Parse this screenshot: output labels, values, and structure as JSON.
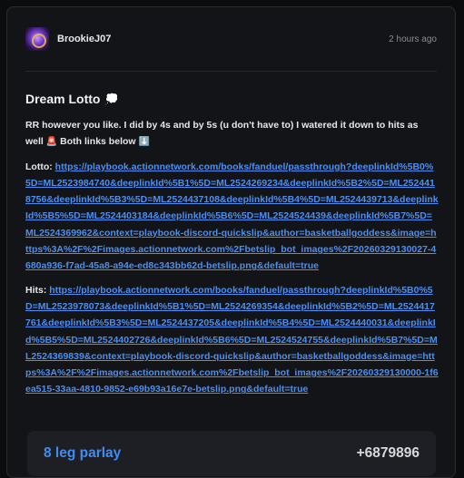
{
  "post": {
    "author": "BrookieJ07",
    "timestamp": "2 hours ago",
    "title": "Dream Lotto",
    "title_emoji": "💭",
    "description": "RR however you like. I did by 4s and by 5s (u don't have to) I watered it down to hits as well",
    "siren_emoji": "🚨",
    "description_tail": "Both links below",
    "arrow_emoji": "⬇️"
  },
  "links": [
    {
      "label": "Lotto:",
      "url": "https://playbook.actionnetwork.com/books/fanduel/passthrough?deeplinkId%5B0%5D=ML2523984740&deeplinkId%5B1%5D=ML2524269234&deeplinkId%5B2%5D=ML2524418756&deeplinkId%5B3%5D=ML2524437108&deeplinkId%5B4%5D=ML2524439713&deeplinkId%5B5%5D=ML2524403184&deeplinkId%5B6%5D=ML2524524439&deeplinkId%5B7%5D=ML2524369962&context=playbook-discord-quickslip&author=basketballgoddess&image=https%3A%2F%2Fimages.actionnetwork.com%2Fbetslip_bot_images%2F20260329130027-4680a936-f7ad-45a8-a94e-ed8c343bb62d-betslip.png&default=true"
    },
    {
      "label": "Hits:",
      "url": "https://playbook.actionnetwork.com/books/fanduel/passthrough?deeplinkId%5B0%5D=ML2523978073&deeplinkId%5B1%5D=ML2524269354&deeplinkId%5B2%5D=ML2524417761&deeplinkId%5B3%5D=ML2524437205&deeplinkId%5B4%5D=ML2524440031&deeplinkId%5B5%5D=ML2524402726&deeplinkId%5B6%5D=ML2524524755&deeplinkId%5B7%5D=ML2524369839&context=playbook-discord-quickslip&author=basketballgoddess&image=https%3A%2F%2Fimages.actionnetwork.com%2Fbetslip_bot_images%2F20260329130000-1f6ea515-33aa-4810-9852-e69b93a16e7e-betslip.png&default=true"
    }
  ],
  "parlay": {
    "name": "8 leg parlay",
    "odds": "+6879896"
  },
  "colors": {
    "background": "#0b0c0e",
    "card": "#131417",
    "link": "#4b8ff0",
    "parlay_name": "#3f8cf2"
  },
  "icons": {
    "avatar": "user-avatar"
  }
}
